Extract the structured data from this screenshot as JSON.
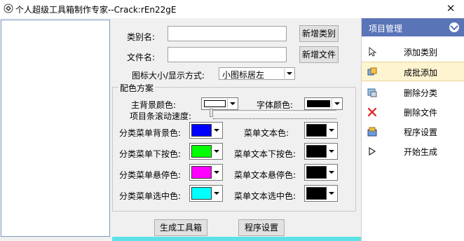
{
  "window": {
    "title": "个人超级工具箱制作专家--Crack:rEn22gE",
    "close_glyph": "✕"
  },
  "form": {
    "category_label": "类别名:",
    "category_value": "",
    "add_category_button": "新增类别",
    "file_label": "文件名:",
    "file_value": "",
    "add_file_button": "新增文件",
    "icon_size_label": "图标大小/显示方式:",
    "icon_size_value": "小图标居左"
  },
  "color_scheme": {
    "title": "配色方案",
    "main_bg_label": "主背景颜色:",
    "font_color_label": "字体颜色:",
    "scroll_speed_label": "项目条滚动速度:",
    "menu_bg_label": "分类菜单背景色:",
    "menu_text_label": "菜单文本色:",
    "menu_pressed_label": "分类菜单下按色:",
    "menu_text_pressed_label": "菜单文本下按色:",
    "menu_hover_label": "分类菜单悬停色:",
    "menu_text_hover_label": "菜单文本悬停色:",
    "menu_selected_label": "分类菜单选中色:",
    "menu_text_selected_label": "菜单文本选中色:",
    "colors": {
      "main_bg": "#ffffff",
      "font": "#000000",
      "menu_bg": "#0000ff",
      "menu_text": "#000000",
      "menu_pressed": "#00ff00",
      "menu_text_pressed": "#000000",
      "menu_hover": "#ff00ff",
      "menu_text_hover": "#000000",
      "menu_selected": "#00ffff",
      "menu_text_selected": "#000000"
    }
  },
  "actions": {
    "generate_button": "生成工具箱",
    "settings_button": "程序设置"
  },
  "panel": {
    "title": "项目管理",
    "items": [
      {
        "label": "添加类别",
        "icon": "cursor-icon"
      },
      {
        "label": "成批添加",
        "icon": "batch-add-icon"
      },
      {
        "label": "删除分类",
        "icon": "delete-category-icon"
      },
      {
        "label": "删除文件",
        "icon": "delete-file-icon"
      },
      {
        "label": "程序设置",
        "icon": "settings-icon"
      },
      {
        "label": "开始生成",
        "icon": "play-icon"
      }
    ]
  }
}
